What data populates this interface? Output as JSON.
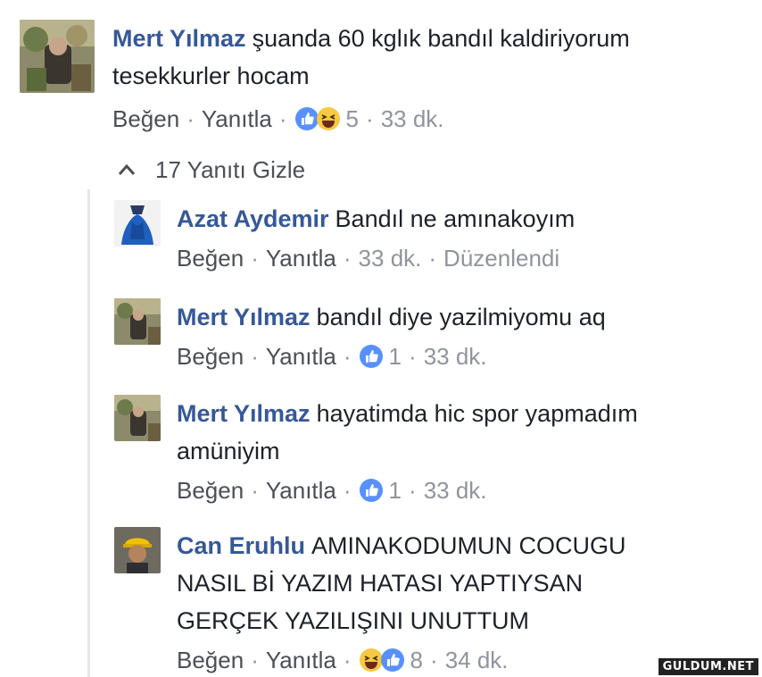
{
  "top_comment": {
    "author": "Mert Yılmaz",
    "text_line1": "şuanda 60 kglık bandıl kaldiriyorum",
    "text_line2": "tesekkurler hocam",
    "like_label": "Beğen",
    "reply_label": "Yanıtla",
    "reaction_count": "5",
    "time": "33 dk."
  },
  "replies_toggle": {
    "label": "17 Yanıtı Gizle",
    "icon": "chevron-up-icon"
  },
  "replies": [
    {
      "author": "Azat Aydemir",
      "lines": [
        "Bandıl ne amınakoyım"
      ],
      "like_label": "Beğen",
      "reply_label": "Yanıtla",
      "time": "33 dk.",
      "edited_label": "Düzenlendi"
    },
    {
      "author": "Mert Yılmaz",
      "lines": [
        "bandıl diye yazilmiyomu aq"
      ],
      "like_label": "Beğen",
      "reply_label": "Yanıtla",
      "reaction_count": "1",
      "time": "33 dk."
    },
    {
      "author": "Mert Yılmaz",
      "lines": [
        "hayatimda hic spor yapmadım",
        "amüniyim"
      ],
      "like_label": "Beğen",
      "reply_label": "Yanıtla",
      "reaction_count": "1",
      "time": "33 dk."
    },
    {
      "author": "Can Eruhlu",
      "lines": [
        "AMINAKODUMUN COCUGU",
        "NASIL Bİ YAZIM HATASI YAPTIYSAN",
        "GERÇEK YAZILIŞINI UNUTTUM"
      ],
      "like_label": "Beğen",
      "reply_label": "Yanıtla",
      "reaction_count": "8",
      "time": "34 dk."
    }
  ],
  "watermark": "GULDUM.NET",
  "colors": {
    "author": "#365899",
    "meta": "#90949c",
    "like_blue": "#5890ff",
    "haha_yellow": "#f7c943"
  }
}
